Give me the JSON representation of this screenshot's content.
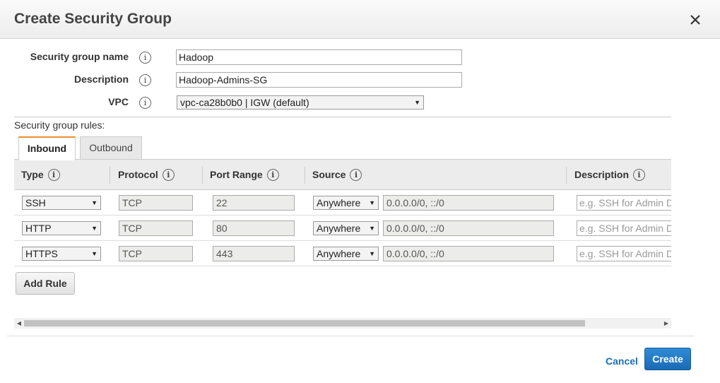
{
  "dialog": {
    "title": "Create Security Group",
    "close_icon": "close-icon"
  },
  "form": {
    "name_label": "Security group name",
    "name_value": "Hadoop",
    "description_label": "Description",
    "description_value": "Hadoop-Admins-SG",
    "vpc_label": "VPC",
    "vpc_value": "vpc-ca28b0b0 | IGW (default)",
    "info_glyph": "i"
  },
  "rules": {
    "heading": "Security group rules:",
    "tabs": [
      {
        "label": "Inbound",
        "active": true
      },
      {
        "label": "Outbound",
        "active": false
      }
    ],
    "columns": [
      "Type",
      "Protocol",
      "Port Range",
      "Source",
      "Description"
    ],
    "rows": [
      {
        "type": "SSH",
        "protocol": "TCP",
        "port": "22",
        "source_type": "Anywhere",
        "source_value": "0.0.0.0/0, ::/0",
        "description_placeholder": "e.g. SSH for Admin D"
      },
      {
        "type": "HTTP",
        "protocol": "TCP",
        "port": "80",
        "source_type": "Anywhere",
        "source_value": "0.0.0.0/0, ::/0",
        "description_placeholder": "e.g. SSH for Admin D"
      },
      {
        "type": "HTTPS",
        "protocol": "TCP",
        "port": "443",
        "source_type": "Anywhere",
        "source_value": "0.0.0.0/0, ::/0",
        "description_placeholder": "e.g. SSH for Admin D"
      }
    ],
    "add_rule_label": "Add Rule"
  },
  "footer": {
    "cancel_label": "Cancel",
    "create_label": "Create"
  },
  "colors": {
    "accent_tab": "#e88f2b",
    "primary_button": "#1a6ab5",
    "link": "#1d6fb5"
  }
}
